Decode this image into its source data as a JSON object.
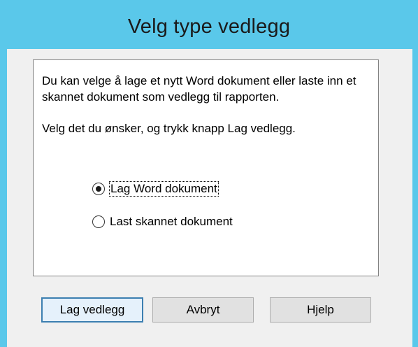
{
  "window": {
    "title": "Velg type vedlegg"
  },
  "info": {
    "paragraph1": "Du kan velge å lage et nytt Word dokument eller laste inn et skannet dokument som vedlegg til rapporten.",
    "paragraph2": "Velg det du ønsker, og trykk knapp Lag vedlegg."
  },
  "options": [
    {
      "label": "Lag Word dokument",
      "selected": true
    },
    {
      "label": "Last skannet dokument",
      "selected": false
    }
  ],
  "buttons": {
    "create": "Lag vedlegg",
    "cancel": "Avbryt",
    "help": "Hjelp"
  },
  "colors": {
    "titlebar": "#5ac8ea",
    "client": "#f0f0f0",
    "default_button_border": "#3c7fb1"
  }
}
